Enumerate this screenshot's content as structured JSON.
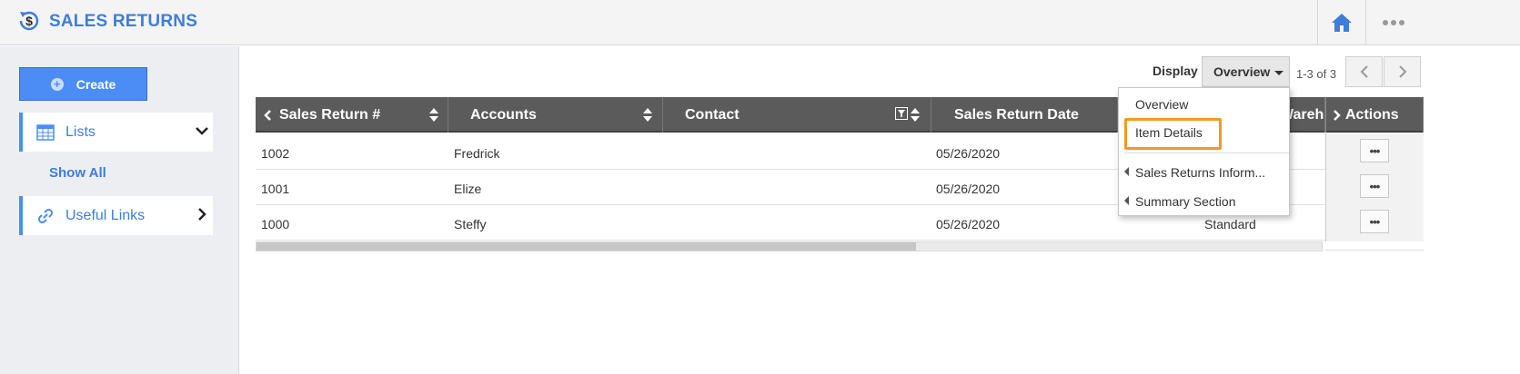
{
  "app": {
    "title": "SALES RETURNS"
  },
  "header": {
    "home_icon": "home-icon",
    "more_icon": "more-dots-icon"
  },
  "sidebar": {
    "create_label": "Create",
    "lists_label": "Lists",
    "show_all_label": "Show All",
    "useful_links_label": "Useful Links"
  },
  "toolbar": {
    "display_label": "Display",
    "display_value": "Overview",
    "pager_text": "1-3 of 3"
  },
  "table": {
    "columns": [
      "Sales Return #",
      "Accounts",
      "Contact",
      "Sales Return Date",
      "Warehou",
      "Actions"
    ],
    "rows": [
      {
        "number": "1002",
        "account": "Fredrick",
        "contact": "",
        "date": "05/26/2020",
        "warehouse": ""
      },
      {
        "number": "1001",
        "account": "Elize",
        "contact": "",
        "date": "05/26/2020",
        "warehouse": ""
      },
      {
        "number": "1000",
        "account": "Steffy",
        "contact": "",
        "date": "05/26/2020",
        "warehouse": "Standard"
      }
    ],
    "action_button_label": "•••"
  },
  "display_menu": {
    "items": [
      "Overview",
      "Item Details",
      "Sales Returns Inform...",
      "Summary Section"
    ],
    "highlighted": "Item Details"
  },
  "colors": {
    "brand": "#3d7ddc",
    "accent": "#4b8df5",
    "highlight": "#f39a1e",
    "header_bg": "#5b5b5b"
  }
}
